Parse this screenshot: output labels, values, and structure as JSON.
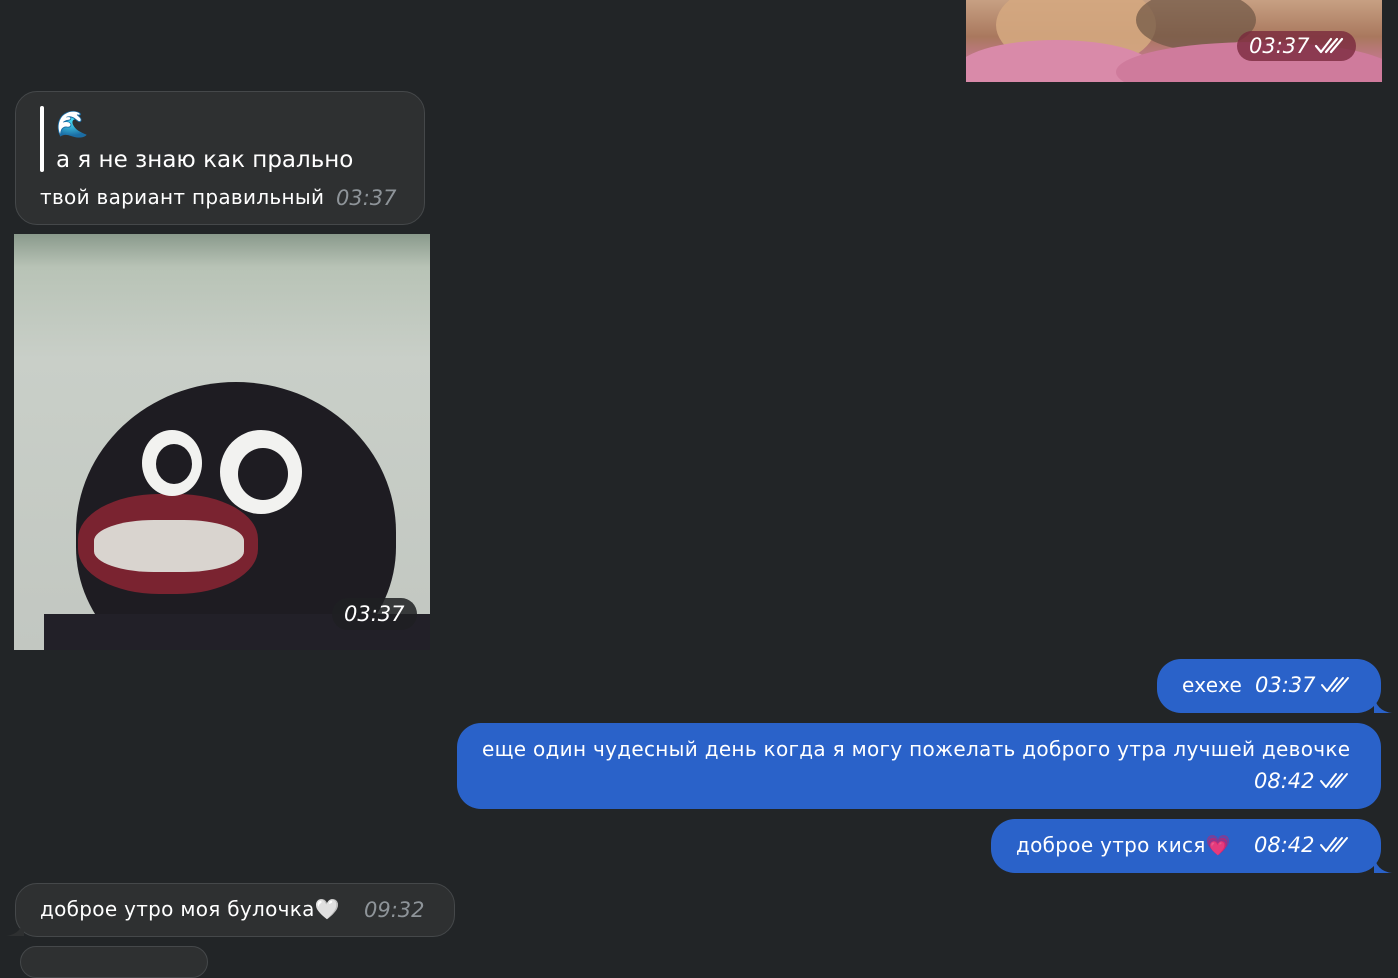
{
  "media_top": {
    "time": "03:37"
  },
  "reply_message": {
    "quoted_emoji": "🌊",
    "quoted_text": "а я не знаю как прально",
    "text": "твой вариант правильный",
    "time": "03:37"
  },
  "sticker": {
    "time": "03:37"
  },
  "outgoing": [
    {
      "text": "exexe",
      "time": "03:37"
    },
    {
      "text": "еще один чудесный день когда я могу пожелать доброго утра лучшей девочке",
      "time": "08:42"
    },
    {
      "text": "доброе утро кися💗",
      "time": "08:42"
    }
  ],
  "incoming_last": {
    "text": "доброе утро моя булочка🤍",
    "time": "09:32"
  },
  "colors": {
    "background": "#222527",
    "incoming_bubble": "#2e3031",
    "outgoing_bubble": "#2a62c9"
  }
}
